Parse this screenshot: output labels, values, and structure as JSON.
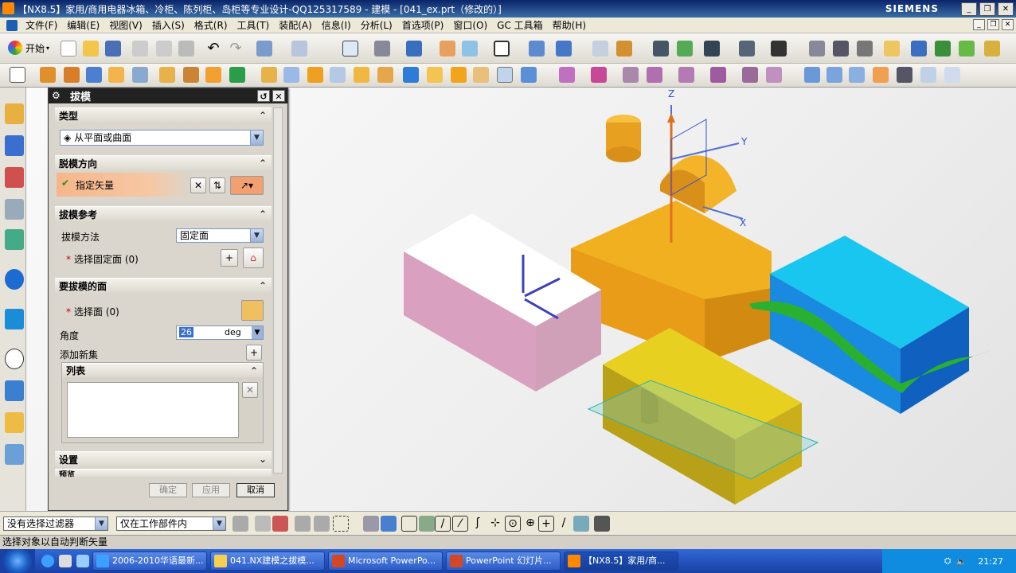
{
  "window": {
    "title": "【NX8.5】家用/商用电器冰箱、冷柜、陈列柜、岛柜等专业设计-QQ125317589 - 建模 - [041_ex.prt（修改的）]",
    "brand": "SIEMENS"
  },
  "menu": [
    "文件(F)",
    "编辑(E)",
    "视图(V)",
    "插入(S)",
    "格式(R)",
    "工具(T)",
    "装配(A)",
    "信息(I)",
    "分析(L)",
    "首选项(P)",
    "窗口(O)",
    "GC 工具箱",
    "帮助(H)"
  ],
  "toolbar": {
    "start_label": "开始"
  },
  "dialog": {
    "title": "拔模",
    "type_section": "类型",
    "type_value": "从平面或曲面",
    "direction_section": "脱模方向",
    "specify_vector": "指定矢量",
    "reference_section": "拔模参考",
    "method_label": "拔模方法",
    "method_value": "固定面",
    "select_fixed": "选择固定面 (0)",
    "faces_section": "要拔模的面",
    "select_face": "选择面 (0)",
    "angle_label": "角度",
    "angle_value": "26",
    "angle_unit": "deg",
    "add_set": "添加新集",
    "list_label": "列表",
    "settings_section": "设置",
    "preview_section": "预览",
    "ok": "确定",
    "apply": "应用",
    "cancel": "取消"
  },
  "filters": {
    "selection_filter": "没有选择过滤器",
    "scope": "仅在工作部件内"
  },
  "status": "选择对象以自动判断矢量",
  "taskbar": {
    "items": [
      "2006-2010华语最新...",
      "041.NX建模之拔模...",
      "Microsoft PowerPo...",
      "PowerPoint 幻灯片...",
      "【NX8.5】家用/商..."
    ],
    "clock": "21:27"
  },
  "axis": {
    "z": "Z",
    "y": "Y",
    "x": "X"
  },
  "colors": {
    "accent": "#e8a060",
    "title_bar": "#0a246a"
  }
}
